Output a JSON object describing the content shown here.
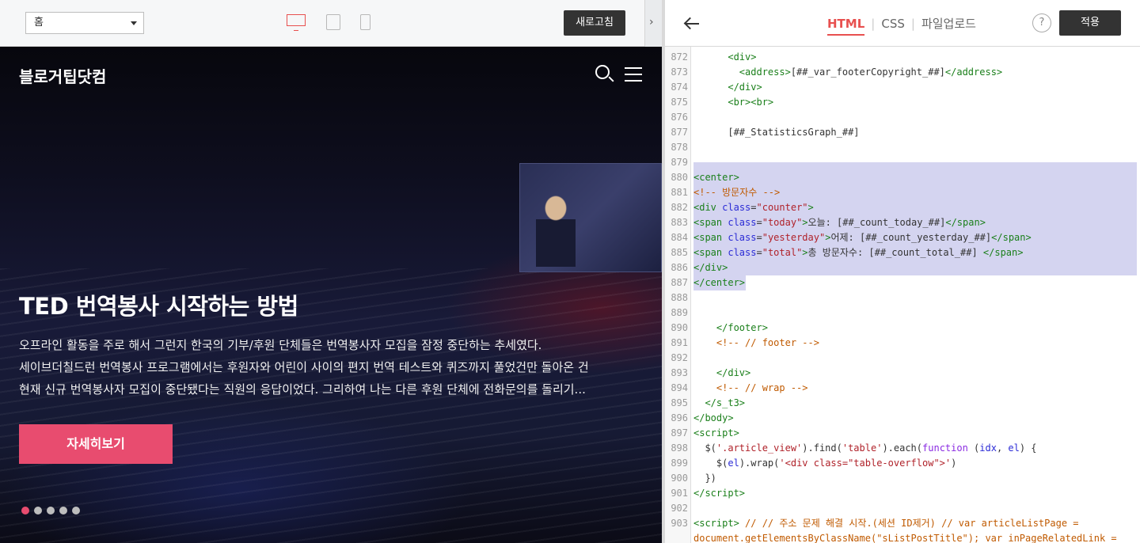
{
  "preview": {
    "page_select": "홈",
    "refresh_label": "새로고침",
    "collapse_glyph": "›",
    "blog": {
      "logo": "블로거팁닷컴",
      "hero_title": "TED 번역봉사 시작하는 방법",
      "hero_lines": [
        "오프라인 활동을 주로 해서 그런지 한국의 기부/후원 단체들은 번역봉사자 모집을 잠정 중단하는 추세였다.",
        "세이브더칠드런 번역봉사 프로그램에서는 후원자와 어린이 사이의 편지 번역 테스트와 퀴즈까지 풀었건만 돌아온 건",
        "현재 신규 번역봉사자 모집이 중단됐다는 직원의 응답이었다. 그리하여 나는 다른 후원 단체에 전화문의를 돌리기..."
      ],
      "more_label": "자세히보기",
      "slide_count": 5,
      "active_slide": 0
    }
  },
  "editor": {
    "tabs": [
      "HTML",
      "CSS",
      "파일업로드"
    ],
    "active_tab": "HTML",
    "help_label": "?",
    "apply_label": "적용",
    "colors": {
      "accent": "#e8504f",
      "pink": "#e84c6f",
      "selection": "#d4d4f0"
    }
  }
}
